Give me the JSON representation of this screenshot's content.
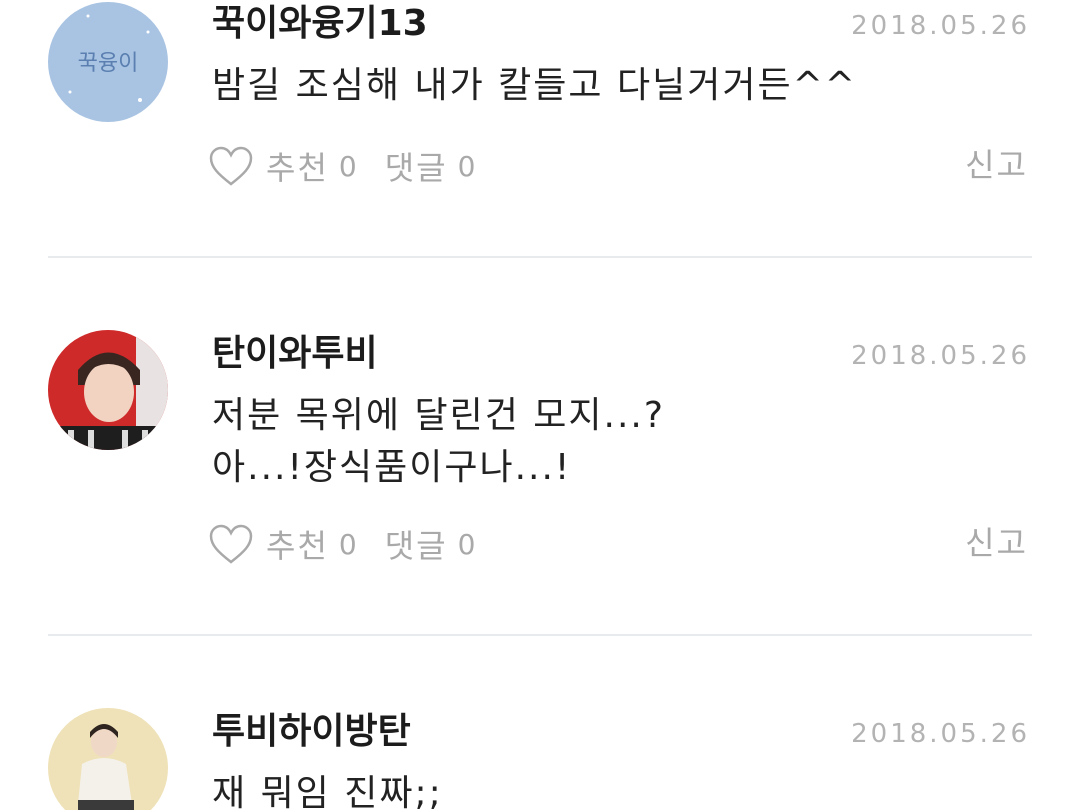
{
  "comments": [
    {
      "username": "꾹이와융기13",
      "date": "2018.05.26",
      "avatar_text": "꾹융이",
      "lines": [
        "밤길 조심해 내가 칼들고 다닐거거든^^"
      ],
      "like_label": "추천",
      "like_count": "0",
      "reply_label": "댓글",
      "reply_count": "0",
      "report_label": "신고"
    },
    {
      "username": "탄이와투비",
      "date": "2018.05.26",
      "lines": [
        "저분 목위에 달린건 모지...?",
        "아...!장식품이구나...!"
      ],
      "like_label": "추천",
      "like_count": "0",
      "reply_label": "댓글",
      "reply_count": "0",
      "report_label": "신고"
    },
    {
      "username": "투비하이방탄",
      "date": "2018.05.26",
      "lines": [
        "재 뭐임 진짜;;"
      ]
    }
  ],
  "colors": {
    "meta_gray": "#a9a9a9",
    "date_gray": "#b3b3b3",
    "divider": "#e7ebee",
    "avatar1_bg": "#a9c4e3"
  },
  "icons": [
    "heart-outline-icon"
  ]
}
